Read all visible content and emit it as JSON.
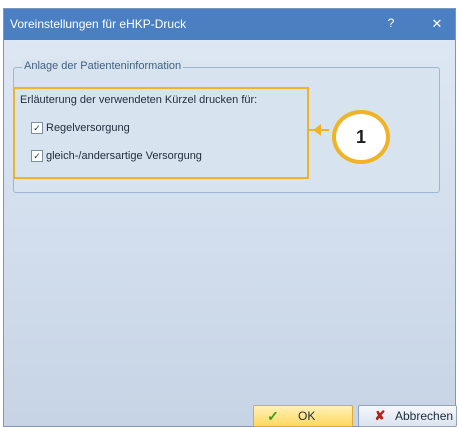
{
  "window": {
    "title": "Voreinstellungen für eHKP-Druck",
    "help_label": "?",
    "close_label": "✕"
  },
  "group": {
    "title": "Anlage der Patienteninformation",
    "lead_text": "Erläuterung der verwendeten Kürzel drucken für:",
    "options": [
      {
        "label": "Regelversorgung",
        "checked": true
      },
      {
        "label": "gleich-/andersartige Versorgung",
        "checked": true
      }
    ]
  },
  "callout": {
    "number": "1"
  },
  "buttons": {
    "ok_label": "OK",
    "cancel_label": "Abbrechen"
  },
  "icons": {
    "check": "✓",
    "cancel": "✘",
    "checkbox_mark": "✓"
  },
  "colors": {
    "titlebar": "#4a80c2",
    "highlight": "#f0b323"
  }
}
